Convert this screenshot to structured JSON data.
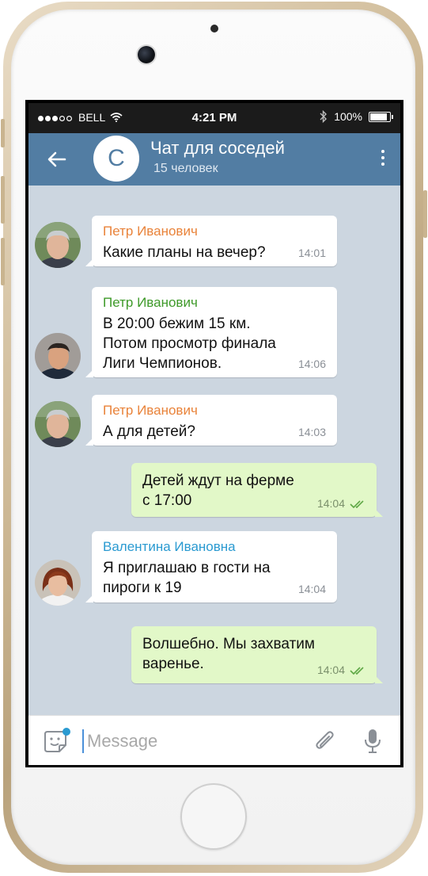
{
  "status_bar": {
    "carrier": "BELL",
    "time": "4:21 PM",
    "battery": "100%",
    "signal_dots_filled": 3,
    "battery_level": 1.0
  },
  "header": {
    "avatar_letter": "С",
    "title": "Чат для соседей",
    "subtitle": "15 человек"
  },
  "messages": [
    {
      "direction": "in",
      "sender": "Петр Иванович",
      "sender_color": "#e9833a",
      "text": "Какие планы на вечер?",
      "time": "14:01"
    },
    {
      "direction": "in",
      "sender": "Петр Иванович",
      "sender_color": "#3f9a2a",
      "text": "В 20:00 бежим 15 км.\nПотом просмотр финала\nЛиги Чемпионов.",
      "time": "14:06"
    },
    {
      "direction": "in",
      "sender": "Петр Иванович",
      "sender_color": "#e9833a",
      "text": "А для детей?",
      "time": "14:03"
    },
    {
      "direction": "out",
      "text": "Детей ждут на ферме\nс 17:00",
      "time": "14:04"
    },
    {
      "direction": "in",
      "sender": "Валентина Ивановна",
      "sender_color": "#2a9ad1",
      "text": "Я приглашаю в гости на\nпироги к 19",
      "time": "14:04"
    },
    {
      "direction": "out",
      "text": "Волшебно. Мы захватим\nваренье.",
      "time": "14:04"
    }
  ],
  "composer": {
    "placeholder": "Message"
  },
  "colors": {
    "header": "#527da3",
    "chat_background": "#ccd6e0",
    "outgoing_bubble": "#e2f8c8",
    "read_ticks": "#5fa846",
    "phone_frame": "#cdb894"
  },
  "icons": {
    "back": "arrow-left-icon",
    "menu": "more-vertical-icon",
    "emoji": "sticker-smile-icon",
    "attach": "paperclip-icon",
    "mic": "microphone-icon",
    "wifi": "wifi-icon",
    "bluetooth": "bluetooth-icon",
    "battery": "battery-icon",
    "read": "double-check-icon"
  }
}
